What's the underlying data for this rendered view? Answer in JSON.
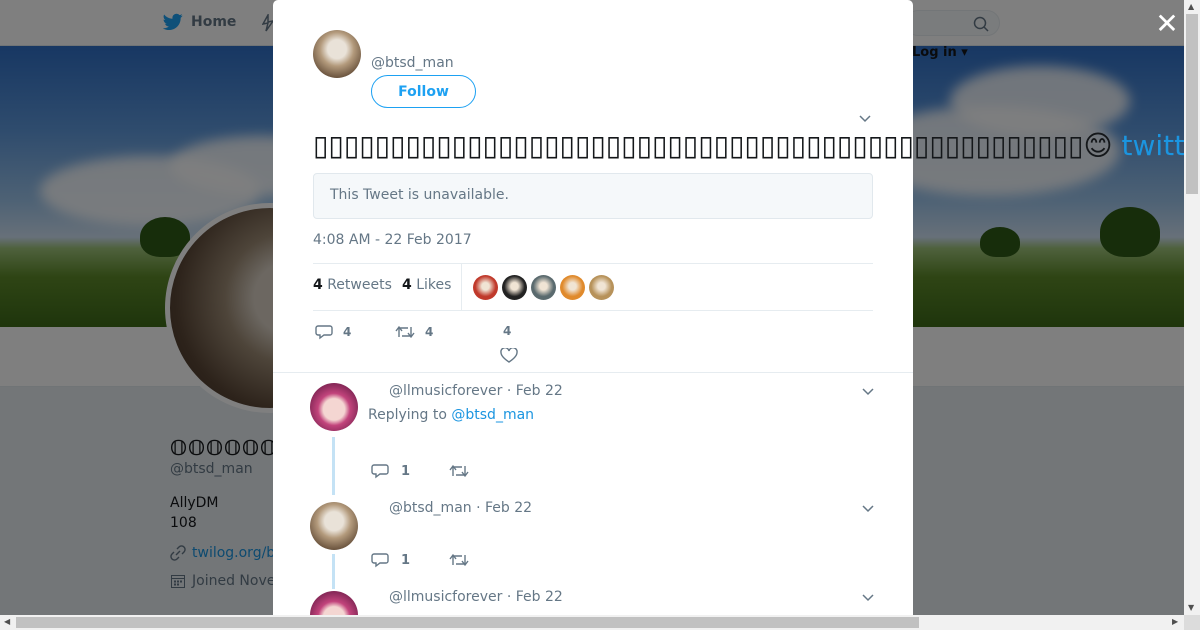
{
  "nav": {
    "home_label": "Home",
    "login_label": "Log in"
  },
  "profile": {
    "name": "𝕆𝕆𝕆𝕆𝕆𝕆𝕆𝕆",
    "handle": "@btsd_man",
    "bio_line1": "AllyDM",
    "bio_line2": "108",
    "link": "twilog.org/b",
    "joined": "Joined Nove"
  },
  "modal": {
    "author_handle": "@btsd_man",
    "follow_label": "Follow",
    "tweet_boxes": "▯▯▯▯▯▯▯▯▯▯▯▯▯▯▯▯▯▯▯▯▯▯▯▯▯▯▯▯▯▯▯▯▯▯▯▯▯▯▯▯▯▯▯▯▯▯▯▯▯▯",
    "tweet_emoji": "😊",
    "tweet_link": " twitter.co",
    "unavailable_text": "This Tweet is unavailable.",
    "timestamp": "4:08 AM - 22 Feb 2017",
    "retweets_count": "4",
    "retweets_label": "Retweets",
    "likes_count": "4",
    "likes_label": "Likes",
    "reply_count": "4",
    "retweet_count": "4",
    "like_count": "4",
    "likers": [
      {
        "color": "#c0392b"
      },
      {
        "color": "#222222"
      },
      {
        "color": "#5a6a6e"
      },
      {
        "color": "#e08a2c"
      },
      {
        "color": "#b7925a"
      }
    ]
  },
  "replies": [
    {
      "handle": "@llmusicforever",
      "date": "Feb 22",
      "replying_prefix": "Replying to",
      "replying_to": "@btsd_man",
      "reply_count": "1"
    },
    {
      "handle": "@btsd_man",
      "date": "Feb 22",
      "reply_count": "1"
    },
    {
      "handle": "@llmusicforever",
      "date": "Feb 22"
    }
  ],
  "colors": {
    "accent": "#1da1f2",
    "link": "#1b95e0",
    "muted": "#657786"
  }
}
